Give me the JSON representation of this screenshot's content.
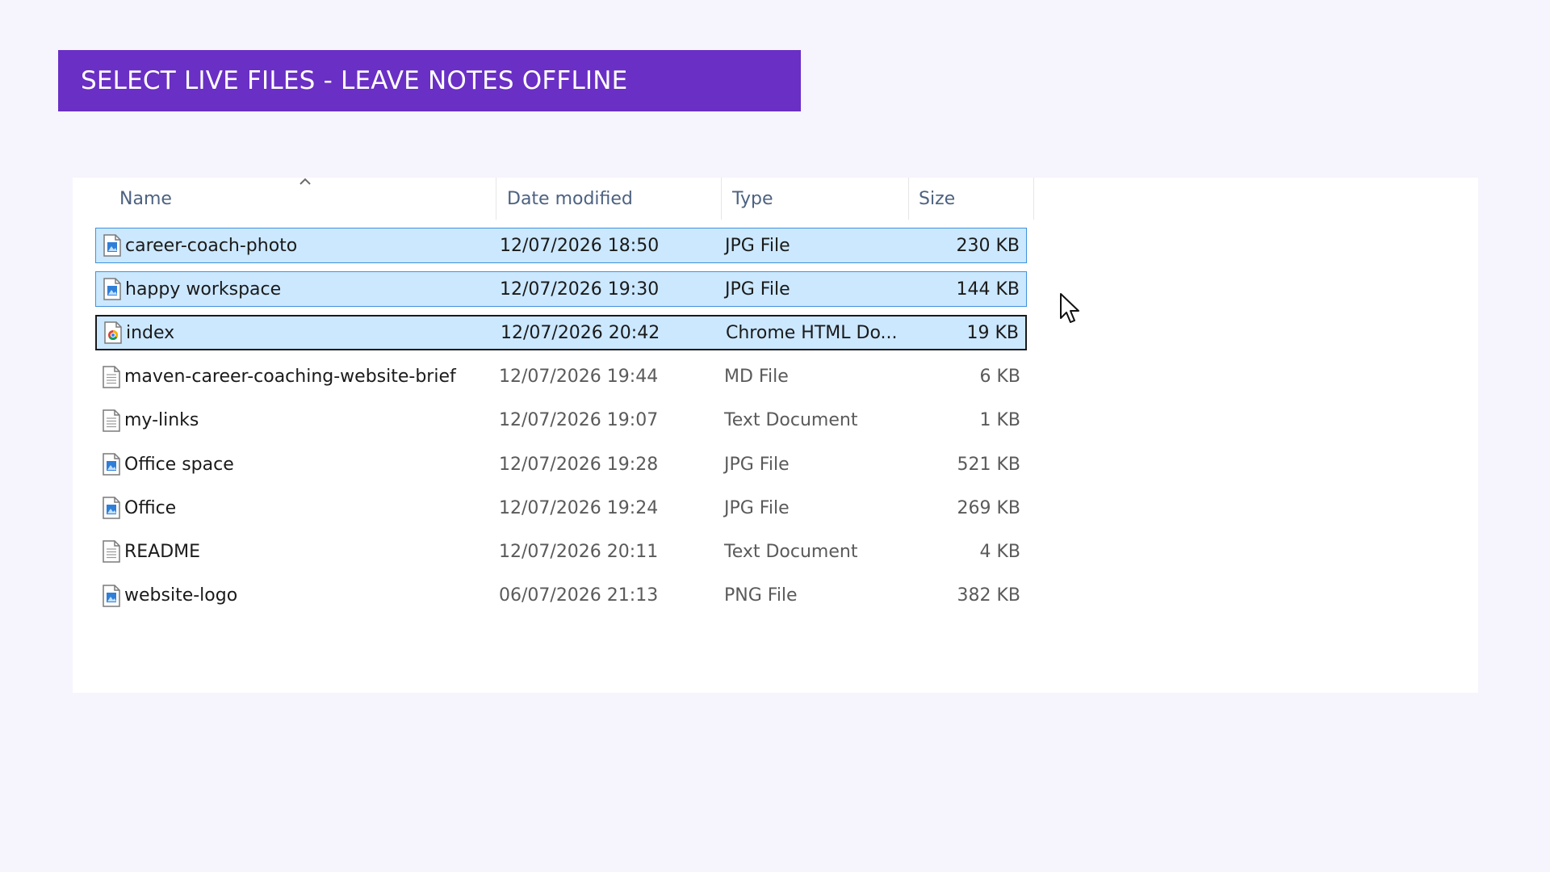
{
  "banner": {
    "title": "SELECT LIVE FILES - LEAVE NOTES OFFLINE"
  },
  "columns": {
    "name": "Name",
    "date": "Date modified",
    "type": "Type",
    "size": "Size"
  },
  "files": [
    {
      "name": "career-coach-photo",
      "date": "12/07/2026 18:50",
      "type": "JPG File",
      "size": "230 KB",
      "icon": "image-file-icon",
      "state": "selected"
    },
    {
      "name": "happy workspace",
      "date": "12/07/2026 19:30",
      "type": "JPG File",
      "size": "144 KB",
      "icon": "image-file-icon",
      "state": "selected"
    },
    {
      "name": "index",
      "date": "12/07/2026 20:42",
      "type": "Chrome HTML Do...",
      "size": "19 KB",
      "icon": "chrome-html-file-icon",
      "state": "focused"
    },
    {
      "name": "maven-career-coaching-website-brief",
      "date": "12/07/2026 19:44",
      "type": "MD File",
      "size": "6 KB",
      "icon": "text-file-icon",
      "state": "normal"
    },
    {
      "name": "my-links",
      "date": "12/07/2026 19:07",
      "type": "Text Document",
      "size": "1 KB",
      "icon": "text-file-icon",
      "state": "normal"
    },
    {
      "name": "Office space",
      "date": "12/07/2026 19:28",
      "type": "JPG File",
      "size": "521 KB",
      "icon": "image-file-icon",
      "state": "normal"
    },
    {
      "name": "Office",
      "date": "12/07/2026 19:24",
      "type": "JPG File",
      "size": "269 KB",
      "icon": "image-file-icon",
      "state": "normal"
    },
    {
      "name": "README",
      "date": "12/07/2026 20:11",
      "type": "Text Document",
      "size": "4 KB",
      "icon": "text-file-icon",
      "state": "normal"
    },
    {
      "name": "website-logo",
      "date": "06/07/2026 21:13",
      "type": "PNG File",
      "size": "382 KB",
      "icon": "image-file-icon",
      "state": "normal"
    }
  ],
  "colors": {
    "banner": "#6a2fc4",
    "selection_fill": "#cce8ff",
    "selection_border": "#3f92dd",
    "focus_border": "#1a1a1a",
    "page_background": "#f6f4fd"
  }
}
